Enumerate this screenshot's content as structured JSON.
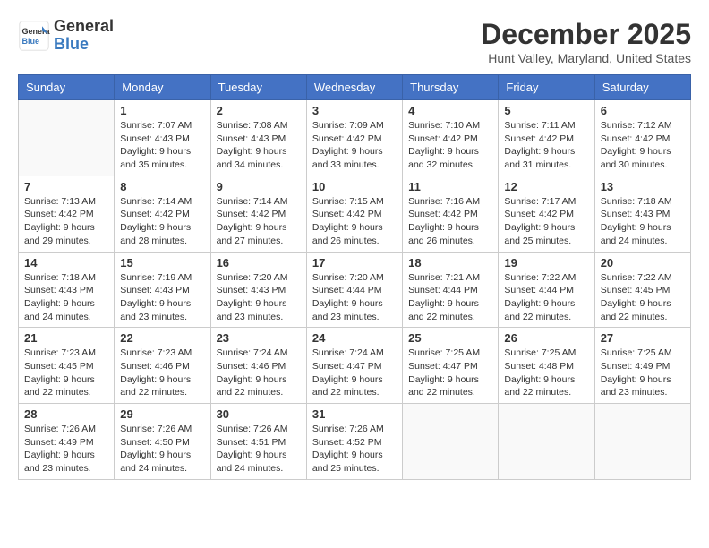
{
  "header": {
    "logo_line1": "General",
    "logo_line2": "Blue",
    "month_title": "December 2025",
    "location": "Hunt Valley, Maryland, United States"
  },
  "days_of_week": [
    "Sunday",
    "Monday",
    "Tuesday",
    "Wednesday",
    "Thursday",
    "Friday",
    "Saturday"
  ],
  "weeks": [
    [
      {
        "day": "",
        "empty": true
      },
      {
        "day": "1",
        "sunrise": "7:07 AM",
        "sunset": "4:43 PM",
        "daylight": "9 hours and 35 minutes."
      },
      {
        "day": "2",
        "sunrise": "7:08 AM",
        "sunset": "4:43 PM",
        "daylight": "9 hours and 34 minutes."
      },
      {
        "day": "3",
        "sunrise": "7:09 AM",
        "sunset": "4:42 PM",
        "daylight": "9 hours and 33 minutes."
      },
      {
        "day": "4",
        "sunrise": "7:10 AM",
        "sunset": "4:42 PM",
        "daylight": "9 hours and 32 minutes."
      },
      {
        "day": "5",
        "sunrise": "7:11 AM",
        "sunset": "4:42 PM",
        "daylight": "9 hours and 31 minutes."
      },
      {
        "day": "6",
        "sunrise": "7:12 AM",
        "sunset": "4:42 PM",
        "daylight": "9 hours and 30 minutes."
      }
    ],
    [
      {
        "day": "7",
        "sunrise": "7:13 AM",
        "sunset": "4:42 PM",
        "daylight": "9 hours and 29 minutes."
      },
      {
        "day": "8",
        "sunrise": "7:14 AM",
        "sunset": "4:42 PM",
        "daylight": "9 hours and 28 minutes."
      },
      {
        "day": "9",
        "sunrise": "7:14 AM",
        "sunset": "4:42 PM",
        "daylight": "9 hours and 27 minutes."
      },
      {
        "day": "10",
        "sunrise": "7:15 AM",
        "sunset": "4:42 PM",
        "daylight": "9 hours and 26 minutes."
      },
      {
        "day": "11",
        "sunrise": "7:16 AM",
        "sunset": "4:42 PM",
        "daylight": "9 hours and 26 minutes."
      },
      {
        "day": "12",
        "sunrise": "7:17 AM",
        "sunset": "4:42 PM",
        "daylight": "9 hours and 25 minutes."
      },
      {
        "day": "13",
        "sunrise": "7:18 AM",
        "sunset": "4:43 PM",
        "daylight": "9 hours and 24 minutes."
      }
    ],
    [
      {
        "day": "14",
        "sunrise": "7:18 AM",
        "sunset": "4:43 PM",
        "daylight": "9 hours and 24 minutes."
      },
      {
        "day": "15",
        "sunrise": "7:19 AM",
        "sunset": "4:43 PM",
        "daylight": "9 hours and 23 minutes."
      },
      {
        "day": "16",
        "sunrise": "7:20 AM",
        "sunset": "4:43 PM",
        "daylight": "9 hours and 23 minutes."
      },
      {
        "day": "17",
        "sunrise": "7:20 AM",
        "sunset": "4:44 PM",
        "daylight": "9 hours and 23 minutes."
      },
      {
        "day": "18",
        "sunrise": "7:21 AM",
        "sunset": "4:44 PM",
        "daylight": "9 hours and 22 minutes."
      },
      {
        "day": "19",
        "sunrise": "7:22 AM",
        "sunset": "4:44 PM",
        "daylight": "9 hours and 22 minutes."
      },
      {
        "day": "20",
        "sunrise": "7:22 AM",
        "sunset": "4:45 PM",
        "daylight": "9 hours and 22 minutes."
      }
    ],
    [
      {
        "day": "21",
        "sunrise": "7:23 AM",
        "sunset": "4:45 PM",
        "daylight": "9 hours and 22 minutes."
      },
      {
        "day": "22",
        "sunrise": "7:23 AM",
        "sunset": "4:46 PM",
        "daylight": "9 hours and 22 minutes."
      },
      {
        "day": "23",
        "sunrise": "7:24 AM",
        "sunset": "4:46 PM",
        "daylight": "9 hours and 22 minutes."
      },
      {
        "day": "24",
        "sunrise": "7:24 AM",
        "sunset": "4:47 PM",
        "daylight": "9 hours and 22 minutes."
      },
      {
        "day": "25",
        "sunrise": "7:25 AM",
        "sunset": "4:47 PM",
        "daylight": "9 hours and 22 minutes."
      },
      {
        "day": "26",
        "sunrise": "7:25 AM",
        "sunset": "4:48 PM",
        "daylight": "9 hours and 22 minutes."
      },
      {
        "day": "27",
        "sunrise": "7:25 AM",
        "sunset": "4:49 PM",
        "daylight": "9 hours and 23 minutes."
      }
    ],
    [
      {
        "day": "28",
        "sunrise": "7:26 AM",
        "sunset": "4:49 PM",
        "daylight": "9 hours and 23 minutes."
      },
      {
        "day": "29",
        "sunrise": "7:26 AM",
        "sunset": "4:50 PM",
        "daylight": "9 hours and 24 minutes."
      },
      {
        "day": "30",
        "sunrise": "7:26 AM",
        "sunset": "4:51 PM",
        "daylight": "9 hours and 24 minutes."
      },
      {
        "day": "31",
        "sunrise": "7:26 AM",
        "sunset": "4:52 PM",
        "daylight": "9 hours and 25 minutes."
      },
      {
        "day": "",
        "empty": true
      },
      {
        "day": "",
        "empty": true
      },
      {
        "day": "",
        "empty": true
      }
    ]
  ],
  "labels": {
    "sunrise": "Sunrise:",
    "sunset": "Sunset:",
    "daylight": "Daylight:"
  }
}
